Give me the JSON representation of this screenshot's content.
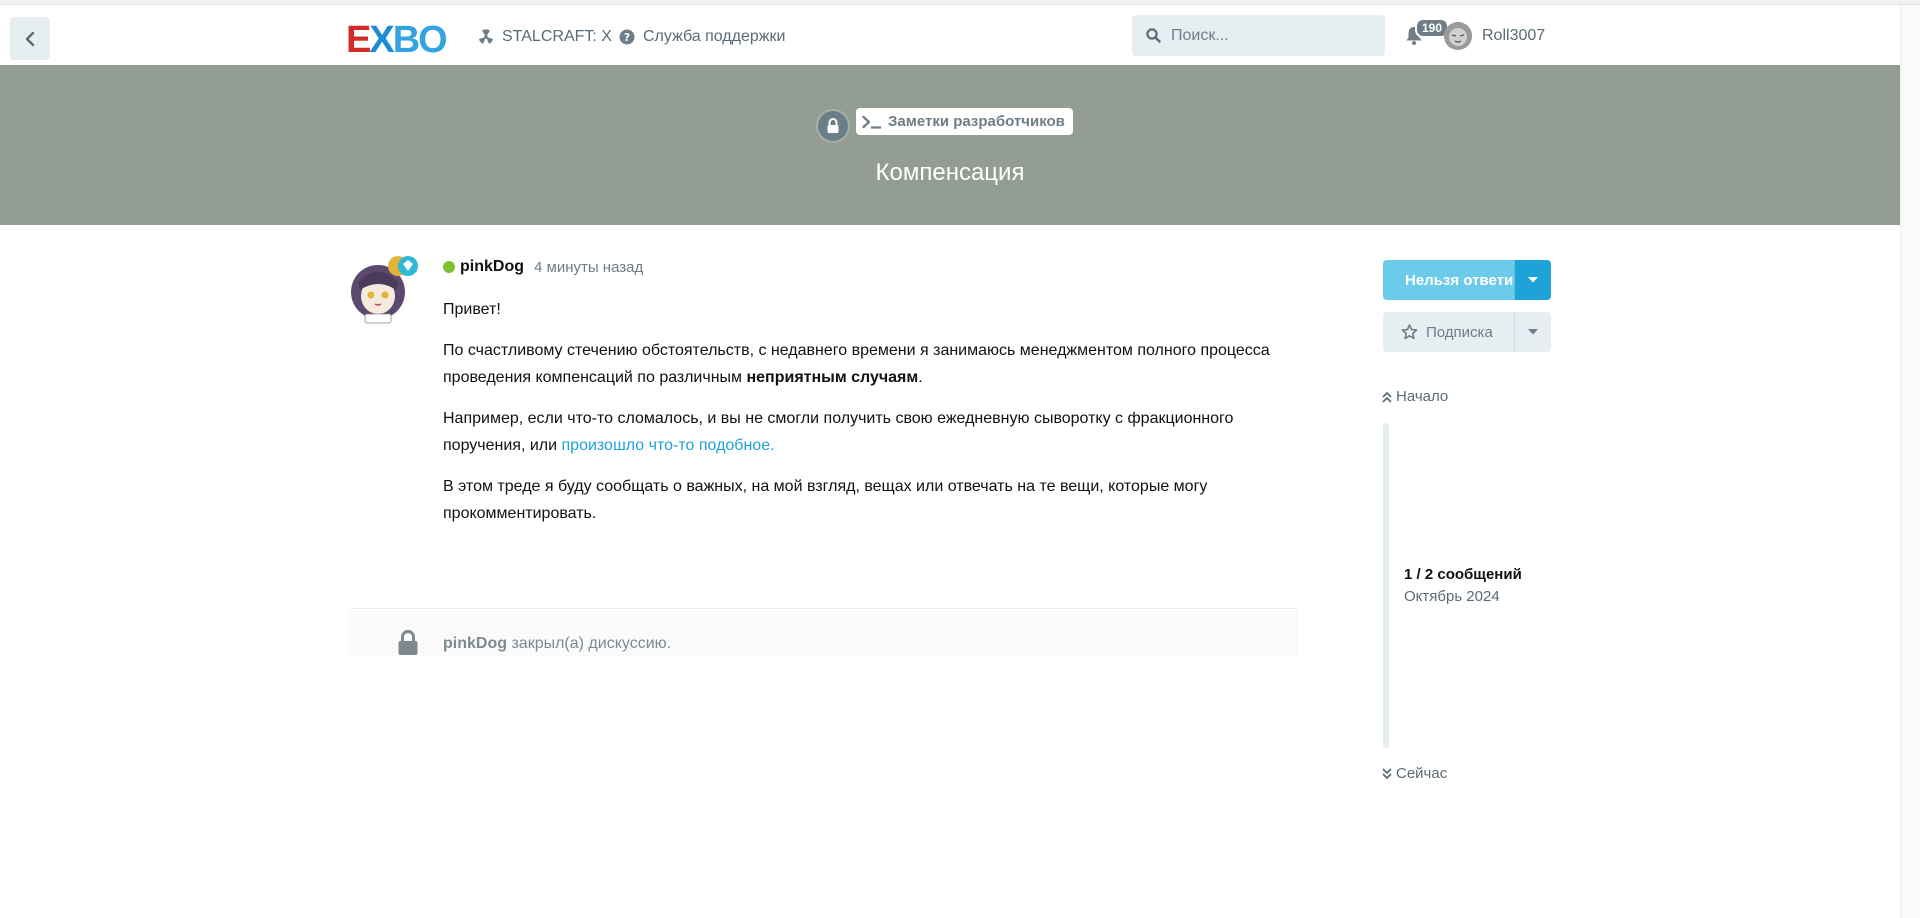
{
  "header": {
    "logo_text_e": "E",
    "logo_text_x": "X",
    "logo_text_bo": "BO",
    "nav_stalcraft": "STALCRAFT: X",
    "nav_support": "Служба поддержки",
    "search_placeholder": "Поиск...",
    "notifications_count": "190",
    "username": "Roll3007"
  },
  "hero": {
    "tag_label": "Заметки разработчиков",
    "title": "Компенсация",
    "background_color": "#939d94"
  },
  "post": {
    "author": "pinkDog",
    "time": "4 минуты назад",
    "p1": "Привет!",
    "p2_text": "По счастливому стечению обстоятельств, с недавнего времени я занимаюсь менеджментом полного процесса проведения компенсаций по различным ",
    "p2_bold": "неприятным случаям",
    "p2_end": ".",
    "p3_text": "Например, если что-то сломалось, и вы не смогли получить свою ежедневную сыворотку с фракционного поручения, или ",
    "p3_link": "произошло что-то подобное.",
    "p4": "В этом треде я буду сообщать о важных, на мой взгляд, вещах или отвечать на те вещи, которые могу прокомментировать."
  },
  "event": {
    "who": "pinkDog",
    "action": "закрыл(а) дискуссию."
  },
  "sidebar": {
    "reply_label": "Нельзя ответить",
    "subscribe_label": "Подписка",
    "scrub_start": "Начало",
    "scrub_count": "1 / 2 сообщений",
    "scrub_date": "Октябрь 2024",
    "scrub_now": "Сейчас"
  },
  "colors": {
    "accent": "#1ea2d8",
    "online": "#7dbf2f"
  }
}
